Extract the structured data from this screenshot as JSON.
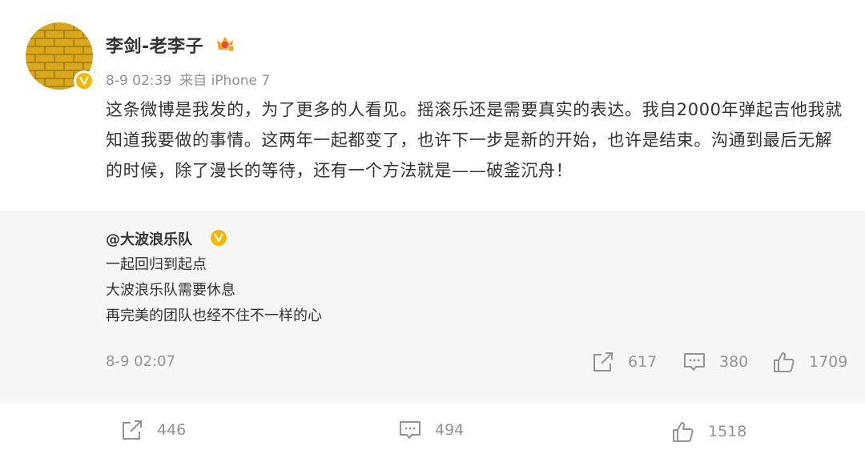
{
  "post": {
    "author": "李剑-老李子",
    "time": "8-9 02:39",
    "source": "来自 iPhone 7",
    "content": "这条微博是我发的，为了更多的人看见。摇滚乐还是需要真实的表达。我自2000年弹起吉他我就知道我要做的事情。这两年一起都变了，也许下一步是新的开始，也许是结束。沟通到最后无解的时候，除了漫长的等待，还有一个方法就是——破釜沉舟！"
  },
  "repost": {
    "author": "@大波浪乐队",
    "lines": [
      "一起回归到起点",
      "大波浪乐队需要休息",
      "再完美的团队也经不住不一样的心"
    ],
    "time": "8-9 02:07",
    "stats": {
      "reposts": "617",
      "comments": "380",
      "likes": "1709"
    }
  },
  "stats": {
    "reposts": "446",
    "comments": "494",
    "likes": "1518"
  },
  "colors": {
    "verified": "#f5b800",
    "muted": "#939393",
    "text": "#333333",
    "repost_bg": "#f7f7f7"
  },
  "icons": {
    "verified": "verified-v-icon",
    "vip": "vip-crown-icon",
    "repost": "repost-icon",
    "comment": "comment-icon",
    "like": "thumbs-up-icon"
  }
}
